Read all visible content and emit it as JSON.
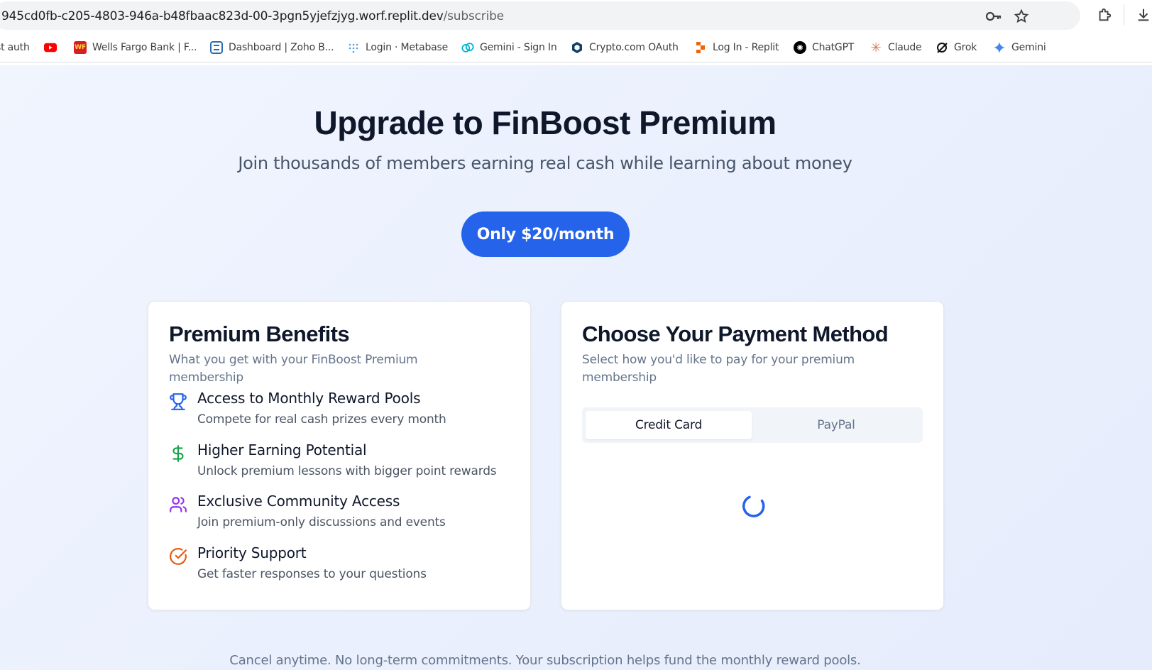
{
  "browser": {
    "url_host": "945cd0fb-c205-4803-946a-b48fbaac823d-00-3pgn5yjefzjyg.worf.replit.dev",
    "url_path": "/subscribe",
    "bookmarks": [
      {
        "label": "st auth"
      },
      {
        "label": "",
        "icon": "youtube-icon"
      },
      {
        "label": "Wells Fargo Bank | F...",
        "icon_text": "WF"
      },
      {
        "label": "Dashboard | Zoho B..."
      },
      {
        "label": "Login · Metabase"
      },
      {
        "label": "Gemini - Sign In"
      },
      {
        "label": "Crypto.com OAuth"
      },
      {
        "label": "Log In - Replit"
      },
      {
        "label": "ChatGPT"
      },
      {
        "label": "Claude"
      },
      {
        "label": "Grok"
      },
      {
        "label": "Gemini"
      }
    ]
  },
  "hero": {
    "title": "Upgrade to FinBoost Premium",
    "subtitle": "Join thousands of members earning real cash while learning about money",
    "price_label": "Only $20/month"
  },
  "benefits_card": {
    "title": "Premium Benefits",
    "description": "What you get with your FinBoost Premium membership",
    "items": [
      {
        "title": "Access to Monthly Reward Pools",
        "desc": "Compete for real cash prizes every month",
        "icon": "trophy-icon",
        "color": "#2563eb"
      },
      {
        "title": "Higher Earning Potential",
        "desc": "Unlock premium lessons with bigger point rewards",
        "icon": "dollar-icon",
        "color": "#16a34a"
      },
      {
        "title": "Exclusive Community Access",
        "desc": "Join premium-only discussions and events",
        "icon": "users-icon",
        "color": "#9333ea"
      },
      {
        "title": "Priority Support",
        "desc": "Get faster responses to your questions",
        "icon": "check-circle-icon",
        "color": "#ea580c"
      }
    ]
  },
  "payment_card": {
    "title": "Choose Your Payment Method",
    "description": "Select how you'd like to pay for your premium membership",
    "tabs": [
      {
        "label": "Credit Card",
        "active": true
      },
      {
        "label": "PayPal",
        "active": false
      }
    ],
    "loading": true
  },
  "footer_note": "Cancel anytime. No long-term commitments. Your subscription helps fund the monthly reward pools.",
  "colors": {
    "accent": "#2563eb",
    "title": "#0f172a",
    "muted": "#64748b"
  }
}
